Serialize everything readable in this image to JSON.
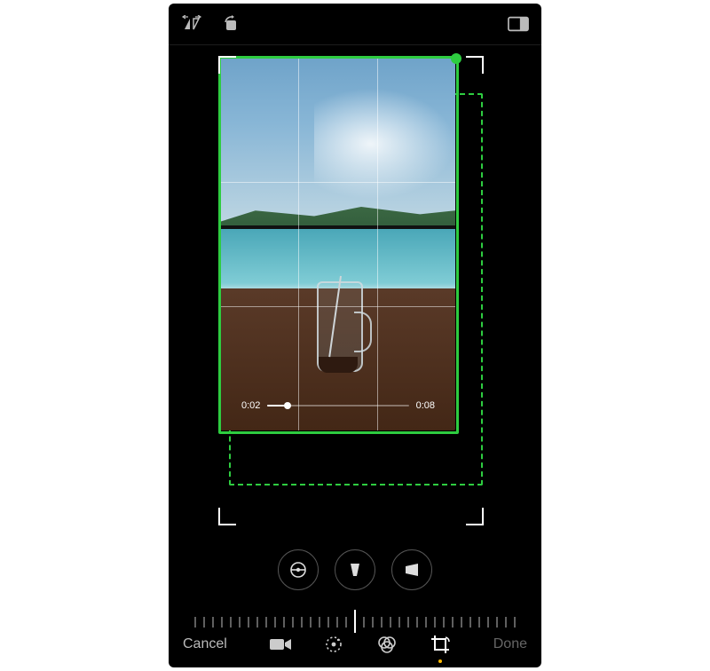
{
  "topbar": {
    "flip_label": "flip-horizontal",
    "rotate_label": "rotate",
    "aspect_label": "aspect-ratio"
  },
  "playback": {
    "current": "0:02",
    "duration": "0:08",
    "progress_pct": 14
  },
  "transform": {
    "straighten": "straighten",
    "vertical": "vertical-perspective",
    "horizontal": "horizontal-perspective"
  },
  "ruler": {
    "value": 0
  },
  "bottombar": {
    "cancel": "Cancel",
    "done": "Done",
    "tools": {
      "video": "video",
      "adjust": "adjust",
      "filters": "filters",
      "crop": "crop"
    },
    "active_tool": "crop"
  },
  "annotation": {
    "crop_solid_color": "#2ecc40",
    "crop_dashed_color": "#2ecc40"
  }
}
